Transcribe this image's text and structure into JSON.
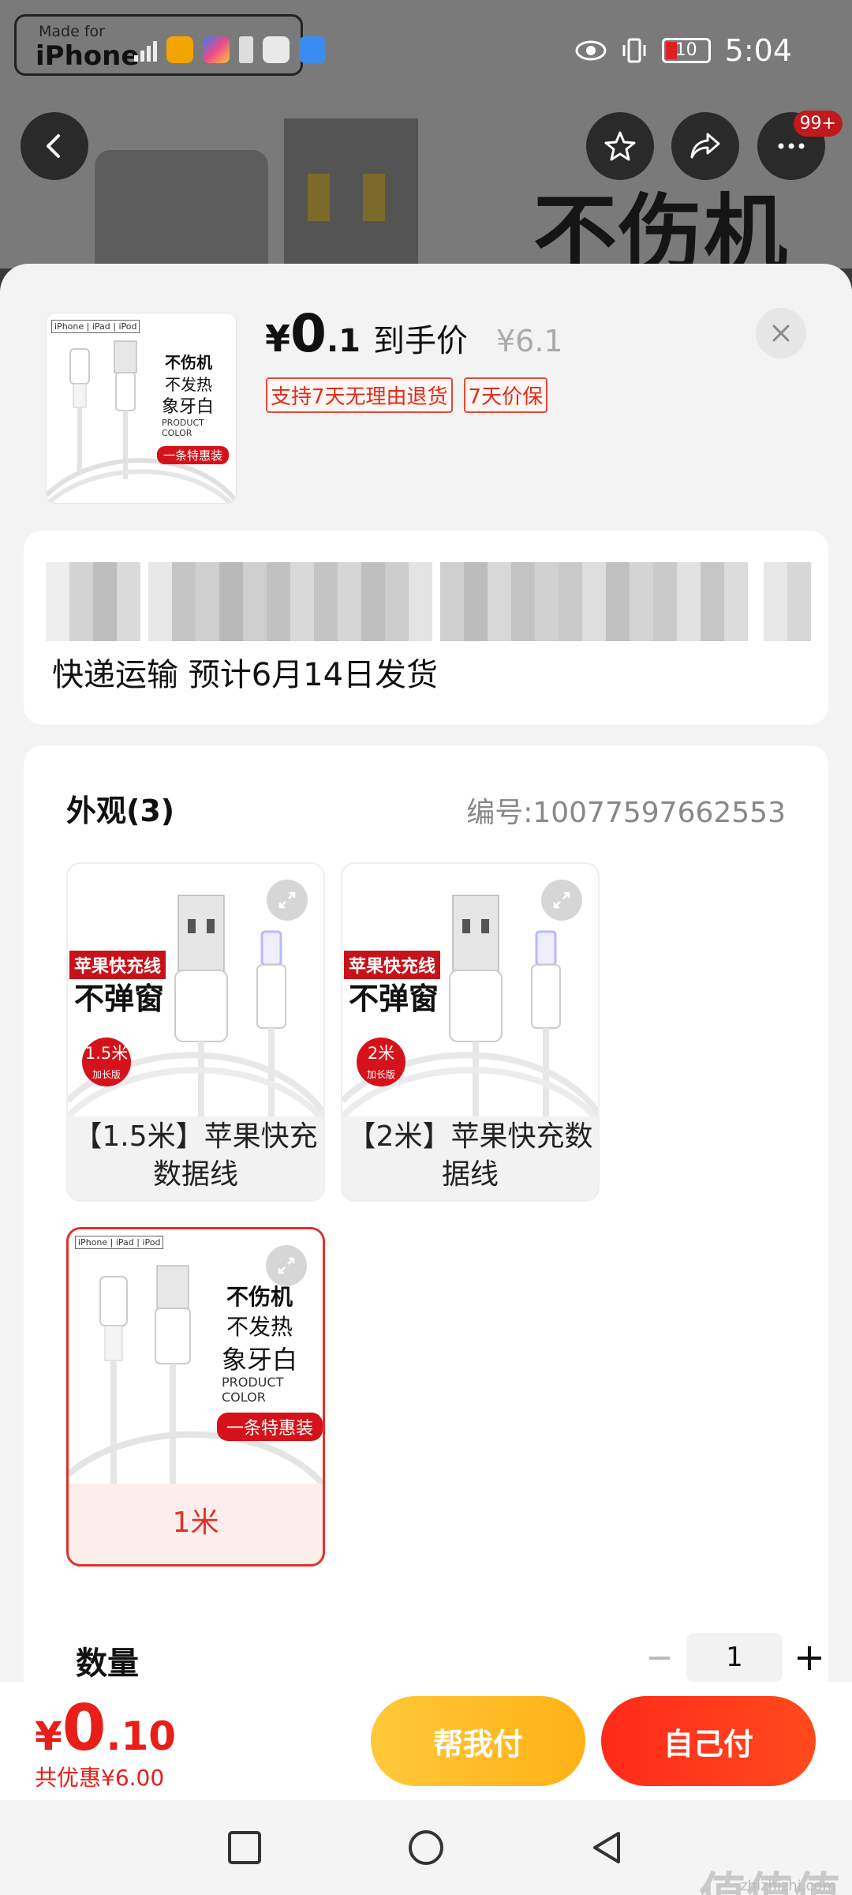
{
  "status_bar": {
    "mfi_small": "Made for",
    "mfi_big": "iPhone",
    "network": "4G",
    "battery": "10",
    "time": "5:04"
  },
  "background": {
    "banner_text": "不伤机",
    "cart_badge": "99+"
  },
  "sheet": {
    "price": {
      "symbol": "¥",
      "integer": "0",
      "decimal": ".1",
      "label": "到手价",
      "original": "¥6.1"
    },
    "tags": [
      "支持7天无理由退货",
      "7天价保"
    ],
    "thumb": {
      "mfi": "iPhone | iPad | iPod",
      "line1": "不伤机",
      "line2": "不发热",
      "line3": "象牙白",
      "line4": "PRODUCT COLOR",
      "promo": "一条特惠装"
    },
    "shipping": "快递运输 预计6月14日发货",
    "spec": {
      "title": "外观(3)",
      "code": "编号:10077597662553",
      "options": [
        {
          "label": "【1.5米】苹果快充数据线",
          "promo_red": "苹果快充线",
          "promo_black": "不弹窗",
          "badge_top": "1.5米",
          "badge_sub": "加长版",
          "selected": false
        },
        {
          "label": "【2米】苹果快充数据线",
          "promo_red": "苹果快充线",
          "promo_black": "不弹窗",
          "badge_top": "2米",
          "badge_sub": "加长版",
          "selected": false
        },
        {
          "label": "1米",
          "selected": true
        }
      ]
    },
    "quantity": {
      "label": "数量",
      "value": "1"
    }
  },
  "bottom": {
    "total": {
      "symbol": "¥",
      "integer": "0",
      "decimal": ".10"
    },
    "discount": "共优惠¥6.00",
    "help_pay": "帮我付",
    "self_pay": "自己付"
  },
  "watermark": {
    "main": "值值值",
    "sub": "zhizhizhi.com"
  },
  "colors": {
    "accent": "#e81e18",
    "help_button": "#ffbe2e",
    "pay_button": "#ff2f1a"
  },
  "icons": [
    "back-icon",
    "star-icon",
    "share-icon",
    "more-icon",
    "close-icon",
    "expand-icon",
    "minus-icon",
    "plus-icon",
    "square-nav-icon",
    "circle-nav-icon",
    "triangle-nav-icon"
  ]
}
